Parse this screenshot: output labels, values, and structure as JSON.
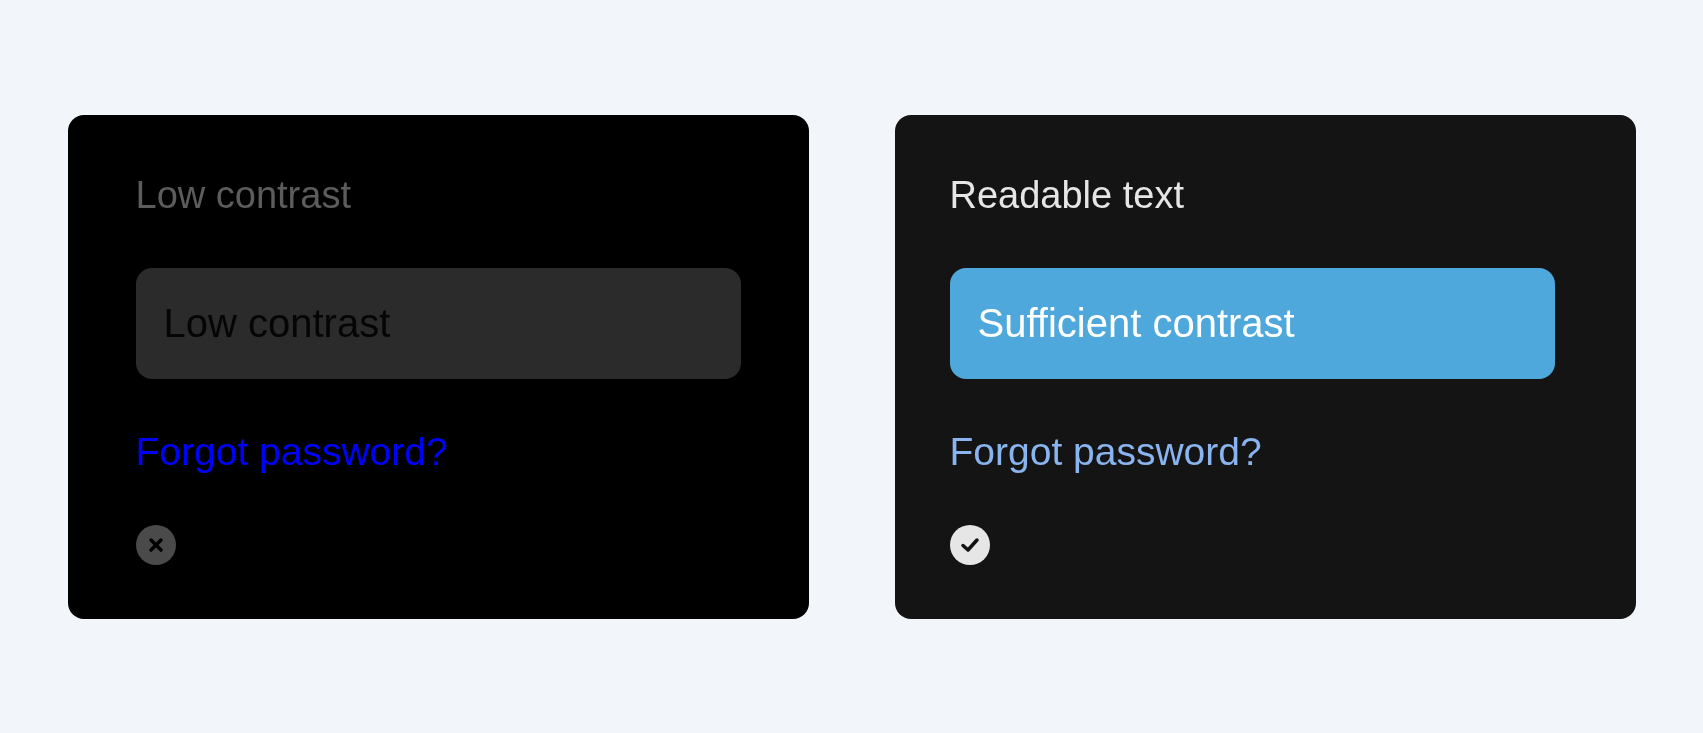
{
  "cards": [
    {
      "kind": "low",
      "title": "Low contrast",
      "button": "Low contrast",
      "link": "Forgot password?",
      "passed": false
    },
    {
      "kind": "readable",
      "title": "Readable text",
      "button": "Sufficient contrast",
      "link": "Forgot password?",
      "passed": true
    }
  ]
}
